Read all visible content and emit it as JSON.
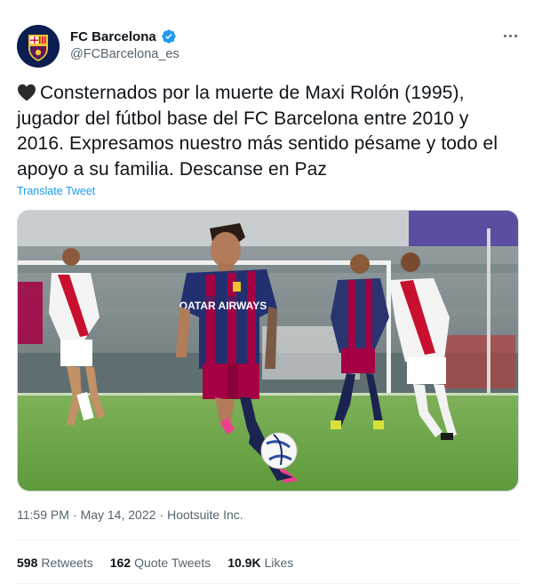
{
  "author": {
    "display_name": "FC Barcelona",
    "handle": "@FCBarcelona_es",
    "verified": true
  },
  "tweet": {
    "text": "Consternados por la muerte de Maxi Rolón (1995), jugador del fútbol base del FC Barcelona entre 2010 y 2016. Expresamos nuestro más sentido pésame y todo el apoyo a su familia. Descanse en Paz",
    "emoji": "black-heart",
    "translate_label": "Translate Tweet"
  },
  "media": {
    "kit_sponsor": "QATAR AIRWAYS",
    "description_icon": "photo-icon"
  },
  "meta": {
    "time": "11:59 PM",
    "separator": "·",
    "date": "May 14, 2022",
    "source": "Hootsuite Inc."
  },
  "stats": {
    "retweets_count": "598",
    "retweets_label": "Retweets",
    "quotes_count": "162",
    "quotes_label": "Quote Tweets",
    "likes_count": "10.9K",
    "likes_label": "Likes"
  },
  "colors": {
    "link": "#1d9bf0",
    "verified": "#1d9bf0",
    "text": "#0f1419",
    "secondary": "#536471",
    "barca_blue": "#1c2a6b",
    "barca_red": "#a50044"
  }
}
